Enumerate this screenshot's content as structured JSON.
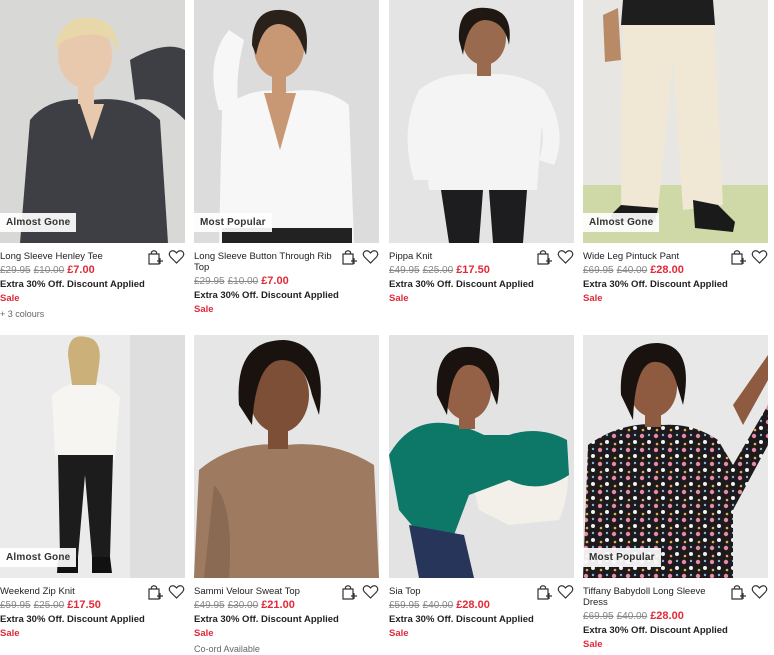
{
  "products": [
    {
      "name": "Long Sleeve Henley Tee",
      "badge": "Almost Gone",
      "price_orig": "£29.95",
      "price_was": "£10.00",
      "price_now": "£7.00",
      "promo": "Extra 30% Off. Discount Applied",
      "sale": "Sale",
      "extra": "+ 3 colours"
    },
    {
      "name": "Long Sleeve Button Through Rib Top",
      "badge": "Most Popular",
      "price_orig": "£29.95",
      "price_was": "£10.00",
      "price_now": "£7.00",
      "promo": "Extra 30% Off. Discount Applied",
      "sale": "Sale",
      "extra": ""
    },
    {
      "name": "Pippa Knit",
      "badge": "",
      "price_orig": "£49.95",
      "price_was": "£25.00",
      "price_now": "£17.50",
      "promo": "Extra 30% Off. Discount Applied",
      "sale": "Sale",
      "extra": ""
    },
    {
      "name": "Wide Leg Pintuck Pant",
      "badge": "Almost Gone",
      "price_orig": "£69.95",
      "price_was": "£40.00",
      "price_now": "£28.00",
      "promo": "Extra 30% Off. Discount Applied",
      "sale": "Sale",
      "extra": ""
    },
    {
      "name": "Weekend Zip Knit",
      "badge": "Almost Gone",
      "price_orig": "£59.95",
      "price_was": "£25.00",
      "price_now": "£17.50",
      "promo": "Extra 30% Off. Discount Applied",
      "sale": "Sale",
      "extra": ""
    },
    {
      "name": "Sammi Velour Sweat Top",
      "badge": "",
      "price_orig": "£49.95",
      "price_was": "£30.00",
      "price_now": "£21.00",
      "promo": "Extra 30% Off. Discount Applied",
      "sale": "Sale",
      "extra": "Co-ord Available"
    },
    {
      "name": "Sia Top",
      "badge": "",
      "price_orig": "£59.95",
      "price_was": "£40.00",
      "price_now": "£28.00",
      "promo": "Extra 30% Off. Discount Applied",
      "sale": "Sale",
      "extra": ""
    },
    {
      "name": "Tiffany Babydoll Long Sleeve Dress",
      "badge": "Most Popular",
      "price_orig": "£69.95",
      "price_was": "£40.00",
      "price_now": "£28.00",
      "promo": "Extra 30% Off. Discount Applied",
      "sale": "Sale",
      "extra": ""
    }
  ],
  "icons": {
    "add_to_bag": "bag-plus-icon",
    "wishlist": "heart-icon"
  },
  "colors": {
    "sale_red": "#e02a3a",
    "struck_grey": "#888888",
    "text": "#222222"
  }
}
